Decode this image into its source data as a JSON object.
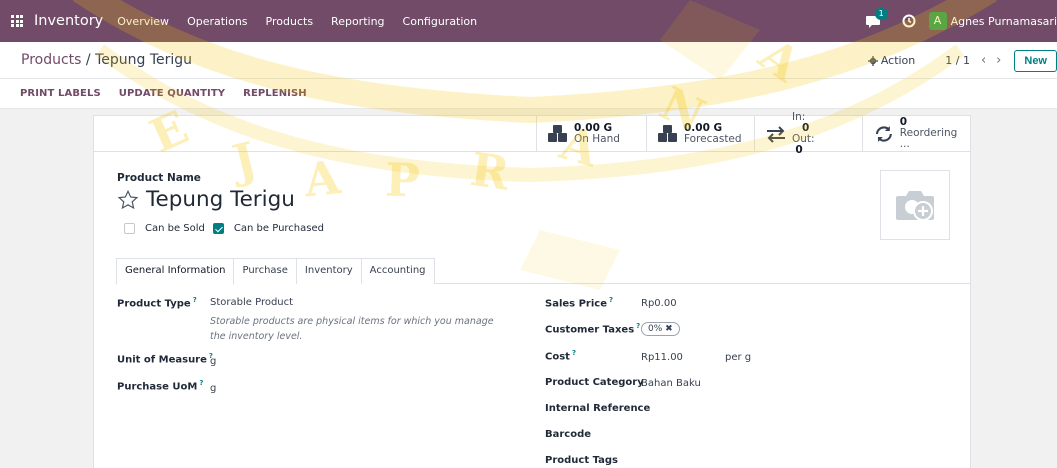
{
  "navbar": {
    "app_name": "Inventory",
    "menu": [
      "Overview",
      "Operations",
      "Products",
      "Reporting",
      "Configuration"
    ],
    "chat_count": "1",
    "user_initial": "A",
    "user_name": "Agnes Purnamasari"
  },
  "control": {
    "breadcrumb_parent": "Products",
    "breadcrumb_sep": " / ",
    "breadcrumb_current": "Tepung Terigu",
    "action_label": "Action",
    "pager": "1 / 1",
    "new_label": "New"
  },
  "actions": [
    "PRINT LABELS",
    "UPDATE QUANTITY",
    "REPLENISH"
  ],
  "smart_buttons": {
    "on_hand_value": "0.00 G",
    "on_hand_label": "On Hand",
    "forecast_value": "0.00 G",
    "forecast_label": "Forecasted",
    "in_label": "In:",
    "in_value": "0",
    "out_label": "Out:",
    "out_value": "0",
    "reorder_value": "0",
    "reorder_label": "Reordering ..."
  },
  "product": {
    "name_label": "Product Name",
    "name": "Tepung Terigu",
    "can_be_sold_label": "Can be Sold",
    "can_be_sold": false,
    "can_be_purchased_label": "Can be Purchased",
    "can_be_purchased": true
  },
  "tabs": [
    "General Information",
    "Purchase",
    "Inventory",
    "Accounting"
  ],
  "general": {
    "product_type_label": "Product Type",
    "product_type": "Storable Product",
    "product_type_hint": "Storable products are physical items for which you manage the inventory level.",
    "uom_label": "Unit of Measure",
    "uom": "g",
    "purchase_uom_label": "Purchase UoM",
    "purchase_uom": "g",
    "sales_price_label": "Sales Price",
    "sales_price": "Rp0.00",
    "customer_taxes_label": "Customer Taxes",
    "customer_taxes": "0%",
    "cost_label": "Cost",
    "cost": "Rp11.00",
    "cost_unit": "per g",
    "product_category_label": "Product Category",
    "product_category": "Bahan Baku",
    "internal_reference_label": "Internal Reference",
    "barcode_label": "Barcode",
    "product_tags_label": "Product Tags"
  },
  "watermark": "SOEGIJAPRANATA",
  "colors": {
    "brand": "#714b67",
    "accent": "#017e84",
    "watermark": "#f5c400"
  },
  "icons": [
    "apps-grid-icon",
    "chat-icon",
    "clock-icon",
    "gear-icon",
    "cubes-icon",
    "transfer-arrows-icon",
    "refresh-icon",
    "star-icon",
    "camera-add-icon"
  ]
}
